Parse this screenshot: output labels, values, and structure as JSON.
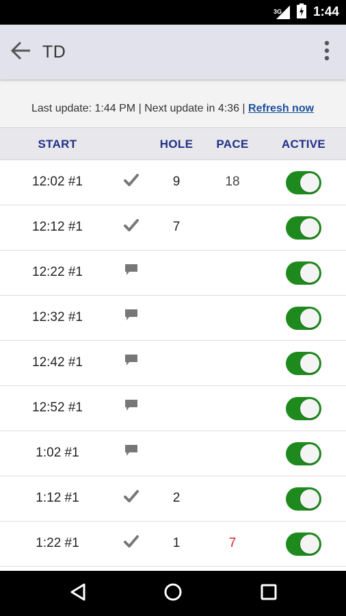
{
  "status_bar": {
    "network_type": "3G",
    "time": "1:44",
    "icons": [
      "signal-icon",
      "battery-icon"
    ]
  },
  "app_bar": {
    "title": "TD",
    "back_icon": "back-arrow-icon",
    "menu_icon": "overflow-menu-icon"
  },
  "update_bar": {
    "last_update_label": "Last update:",
    "last_update_time": "1:44 PM",
    "separator": "|",
    "next_update_label": "Next update in",
    "next_update_countdown": "4:36",
    "refresh_label": "Refresh now"
  },
  "table": {
    "headers": [
      "START",
      "HOLE",
      "PACE",
      "ACTIVE"
    ],
    "rows": [
      {
        "start": "12:02 #1",
        "status_icon": "check-icon",
        "hole": "9",
        "pace": "18",
        "pace_alert": false,
        "active": true
      },
      {
        "start": "12:12 #1",
        "status_icon": "check-icon",
        "hole": "7",
        "pace": "",
        "pace_alert": false,
        "active": true
      },
      {
        "start": "12:22 #1",
        "status_icon": "message-icon",
        "hole": "",
        "pace": "",
        "pace_alert": false,
        "active": true
      },
      {
        "start": "12:32 #1",
        "status_icon": "message-icon",
        "hole": "",
        "pace": "",
        "pace_alert": false,
        "active": true
      },
      {
        "start": "12:42 #1",
        "status_icon": "message-icon",
        "hole": "",
        "pace": "",
        "pace_alert": false,
        "active": true
      },
      {
        "start": "12:52 #1",
        "status_icon": "message-icon",
        "hole": "",
        "pace": "",
        "pace_alert": false,
        "active": true
      },
      {
        "start": "1:02 #1",
        "status_icon": "message-icon",
        "hole": "",
        "pace": "",
        "pace_alert": false,
        "active": true
      },
      {
        "start": "1:12 #1",
        "status_icon": "check-icon",
        "hole": "2",
        "pace": "",
        "pace_alert": false,
        "active": true
      },
      {
        "start": "1:22 #1",
        "status_icon": "check-icon",
        "hole": "1",
        "pace": "7",
        "pace_alert": true,
        "active": true
      }
    ]
  },
  "colors": {
    "header_text": "#1f2f86",
    "toggle_on": "#1e8a1e",
    "pace_alert": "#e02020",
    "link": "#1a4f9c",
    "app_bar_bg": "#e2e2ec"
  },
  "nav_bar": {
    "buttons": [
      "back-triangle-icon",
      "home-circle-icon",
      "recents-square-icon"
    ]
  }
}
